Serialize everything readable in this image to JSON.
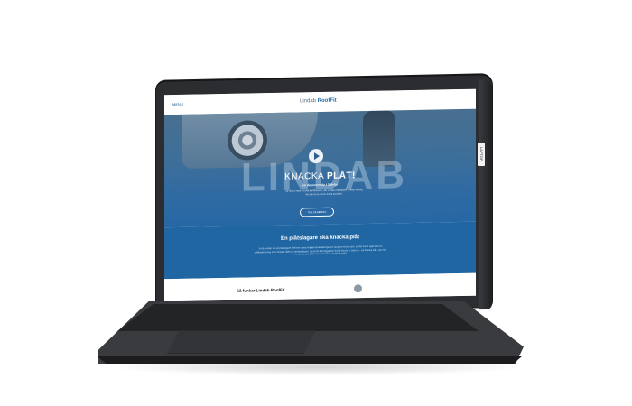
{
  "device": {
    "side_label": "LAPTOP"
  },
  "site": {
    "menu_label": "MENU",
    "brand_prefix": "Lindab ",
    "brand_bold": "RoofFit",
    "hero": {
      "big_word": "LINDAB",
      "title_prefix": "KNACKA ",
      "title_bold": "PLÅT!",
      "subtitle": "en dokumentär i 3 delar",
      "body": "I år firar vi med en unik kortfilmserie, där vi följer plåtslagare i deras vardag. Nu kan du ta del av första avsnittet.",
      "button_label": "TILL FILMERNA"
    },
    "section": {
      "title": "En plåtslagare ska knacka plåt",
      "body": "Vi på Lindab vet att plåtslagare behöver bästa möjliga förutsättningar för att göra ett bra jobb. Därför har vi tagit fram en plåtbearbetning som minskar tiden på arbetsplatsen, så att du kan lägga mer tid på det du är bäst på – att knacka plåt. Läs mer om hur du kan jobba smartare med Lindab RoofFit."
    },
    "strip": {
      "heading": "Så funkar Lindab RoofFit"
    }
  },
  "colors": {
    "brand_blue": "#1f66a3",
    "header_text": "#5a6b7c",
    "device_body": "#2c2d30"
  }
}
